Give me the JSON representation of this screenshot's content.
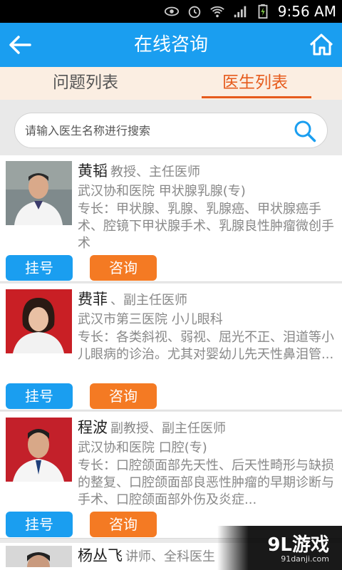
{
  "status_bar": {
    "time": "9:56 AM"
  },
  "header": {
    "title": "在线咨询"
  },
  "tabs": [
    {
      "label": "问题列表",
      "active": false
    },
    {
      "label": "医生列表",
      "active": true
    }
  ],
  "search": {
    "placeholder": "请输入医生名称进行搜索"
  },
  "doctors": [
    {
      "name": "黄韬",
      "titles": "教授、主任医师",
      "hospital": "武汉协和医院 甲状腺乳腺(专)",
      "specialty": "专长：甲状腺、乳腺、乳腺癌、甲状腺癌手术、腔镜下甲状腺手术、乳腺良性肿瘤微创手术",
      "register_label": "挂号",
      "consult_label": "咨询"
    },
    {
      "name": "费菲",
      "titles": "、副主任医师",
      "hospital": "武汉市第三医院 小儿眼科",
      "specialty": "专长：各类斜视、弱视、屈光不正、泪道等小儿眼病的诊治。尤其对婴幼儿先天性鼻泪管...",
      "register_label": "挂号",
      "consult_label": "咨询"
    },
    {
      "name": "程波",
      "titles": "副教授、副主任医师",
      "hospital": "武汉协和医院 口腔(专)",
      "specialty": "专长：口腔颌面部先天性、后天性畸形与缺损的整复、口腔颌面部良恶性肿瘤的早期诊断与手术、口腔颌面部外伤及炎症...",
      "register_label": "挂号",
      "consult_label": "咨询"
    },
    {
      "name": "杨丛飞",
      "titles": "讲师、全科医生"
    }
  ],
  "watermark": {
    "logo": "9L游戏",
    "url": "91danji.com"
  },
  "colors": {
    "primary": "#1a9ef0",
    "accent": "#f47a23",
    "tab_active": "#e65b1c"
  }
}
